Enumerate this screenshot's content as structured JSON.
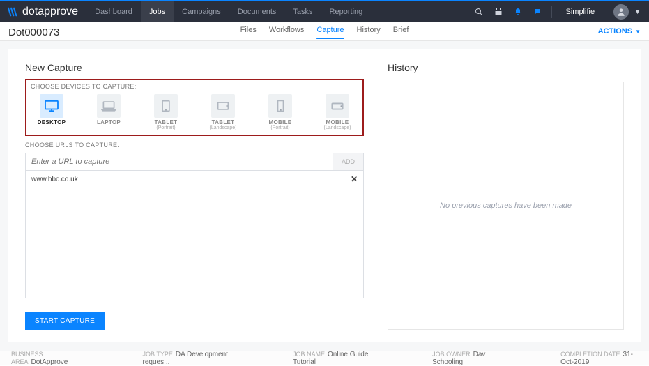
{
  "brand": "dotapprove",
  "nav": {
    "items": [
      "Dashboard",
      "Jobs",
      "Campaigns",
      "Documents",
      "Tasks",
      "Reporting"
    ],
    "active_index": 1,
    "username": "Simplifie"
  },
  "subhead": {
    "job_id": "Dot000073",
    "tabs": [
      "Files",
      "Workflows",
      "Capture",
      "History",
      "Brief"
    ],
    "active_tab_index": 2,
    "actions_label": "ACTIONS"
  },
  "capture": {
    "title": "New Capture",
    "devices_label": "CHOOSE DEVICES TO CAPTURE:",
    "devices": [
      {
        "name": "DESKTOP",
        "sub": ""
      },
      {
        "name": "LAPTOP",
        "sub": ""
      },
      {
        "name": "TABLET",
        "sub": "(Portrait)"
      },
      {
        "name": "TABLET",
        "sub": "(Landscape)"
      },
      {
        "name": "MOBILE",
        "sub": "(Portrait)"
      },
      {
        "name": "MOBILE",
        "sub": "(Landscape)"
      }
    ],
    "active_device_index": 0,
    "urls_label": "CHOOSE URLS TO CAPTURE:",
    "url_placeholder": "Enter a URL to capture",
    "add_label": "ADD",
    "urls": [
      "www.bbc.co.uk"
    ],
    "start_label": "START CAPTURE"
  },
  "history": {
    "title": "History",
    "empty_message": "No previous captures have been made"
  },
  "footer": {
    "business_area": {
      "label": "BUSINESS AREA",
      "value": "DotApprove"
    },
    "job_type": {
      "label": "JOB TYPE",
      "value": "DA Development reques..."
    },
    "job_name": {
      "label": "JOB NAME",
      "value": "Online Guide Tutorial"
    },
    "job_owner": {
      "label": "JOB OWNER",
      "value": "Dav Schooling"
    },
    "completion": {
      "label": "COMPLETION DATE",
      "value": "31-Oct-2019"
    }
  }
}
